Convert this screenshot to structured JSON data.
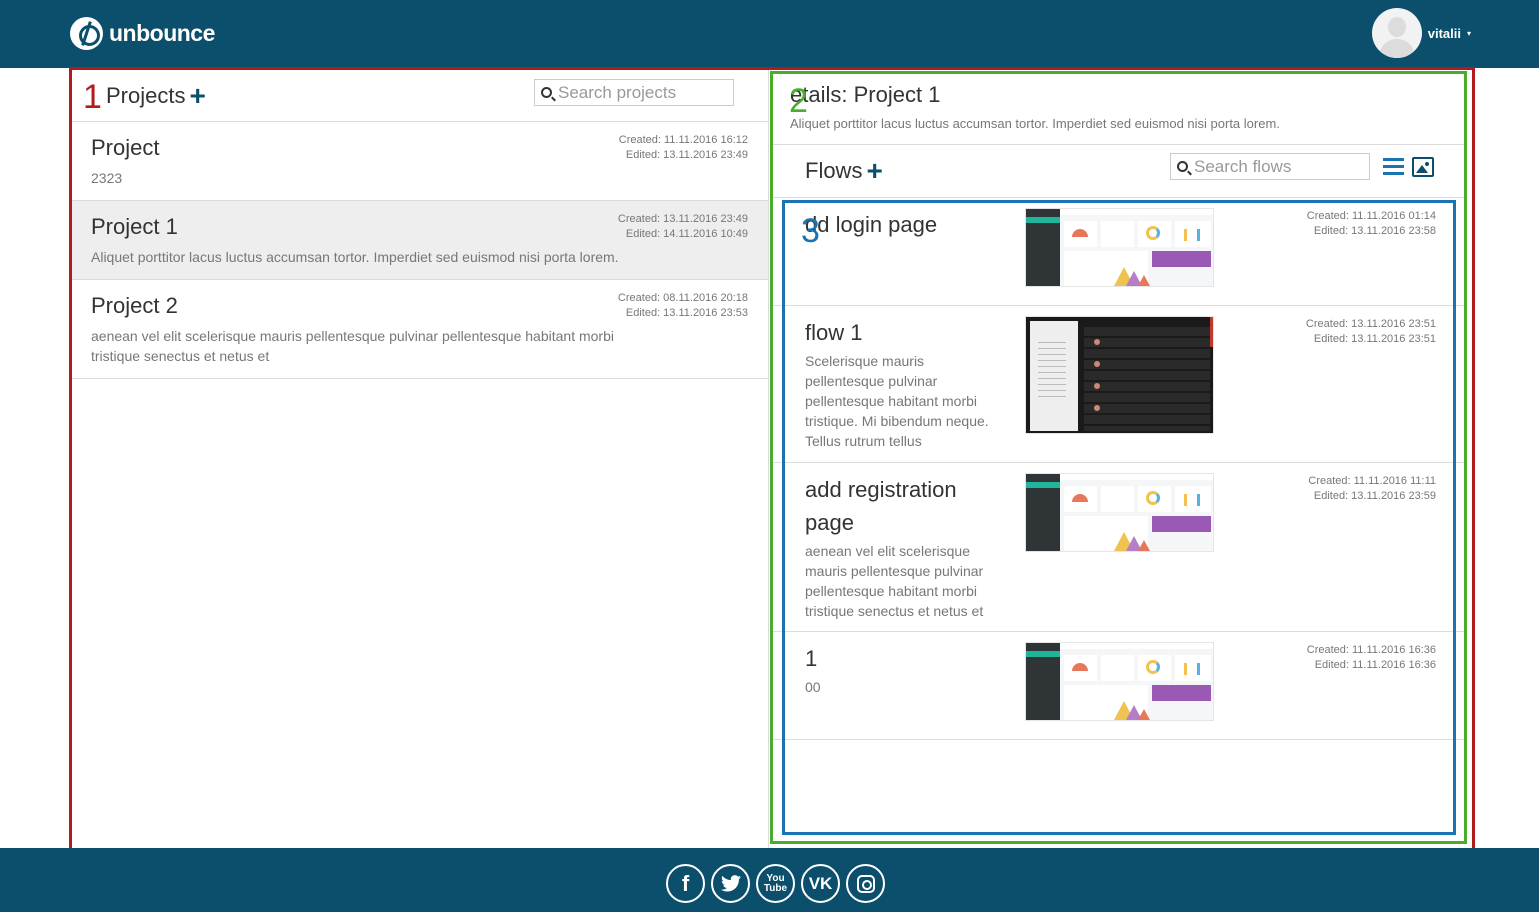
{
  "header": {
    "logo_text": "unbounce",
    "user_name": "vitalii",
    "caret": "▾"
  },
  "markers": {
    "one": "1",
    "two": "2",
    "three": "3"
  },
  "projects_panel": {
    "title": "Projects",
    "add_symbol": "+",
    "search_placeholder": "Search projects",
    "items": [
      {
        "title": "Project",
        "description": "2323",
        "created": "Created: 11.11.2016 16:12",
        "edited": "Edited: 13.11.2016 23:49"
      },
      {
        "title": "Project 1",
        "description": "Aliquet porttitor lacus luctus accumsan tortor. Imperdiet sed euismod nisi porta lorem.",
        "created": "Created: 13.11.2016 23:49",
        "edited": "Edited: 14.11.2016 10:49"
      },
      {
        "title": "Project 2",
        "description": "aenean vel elit scelerisque mauris pellentesque pulvinar pellentesque habitant morbi tristique senectus et netus et",
        "created": "Created: 08.11.2016 20:18",
        "edited": "Edited: 13.11.2016 23:53"
      }
    ]
  },
  "details_panel": {
    "title": "etails: Project 1",
    "description": "Aliquet porttitor lacus luctus accumsan tortor. Imperdiet sed euismod nisi porta lorem.",
    "flows_title": "Flows",
    "add_symbol": "+",
    "search_placeholder": "Search flows",
    "flows": [
      {
        "title": "dd login page",
        "description": "",
        "created": "Created: 11.11.2016 01:14",
        "edited": "Edited: 13.11.2016 23:58"
      },
      {
        "title": "flow 1",
        "description": "Scelerisque mauris pellentesque pulvinar pellentesque habitant morbi tristique. Mi bibendum neque. Tellus rutrum tellus",
        "created": "Created: 13.11.2016 23:51",
        "edited": "Edited: 13.11.2016 23:51"
      },
      {
        "title": "add registration page",
        "description": "aenean vel elit scelerisque mauris pellentesque pulvinar pellentesque habitant morbi tristique senectus et netus et",
        "created": "Created: 11.11.2016 11:11",
        "edited": "Edited: 13.11.2016 23:59"
      },
      {
        "title": "1",
        "description": "00",
        "created": "Created: 11.11.2016 16:36",
        "edited": "Edited: 11.11.2016 16:36"
      }
    ]
  },
  "footer": {
    "facebook": "f",
    "youtube_top": "You",
    "youtube_bottom": "Tube",
    "vk": "VK"
  },
  "colors": {
    "brand": "#0b4f6c",
    "frame_red": "#b01c1c",
    "frame_green": "#47ad2a",
    "frame_blue": "#1a73b3"
  },
  "icons": [
    "search-icon",
    "plus-icon",
    "list-view-icon",
    "image-view-icon",
    "facebook-icon",
    "twitter-icon",
    "youtube-icon",
    "vk-icon",
    "instagram-icon"
  ]
}
